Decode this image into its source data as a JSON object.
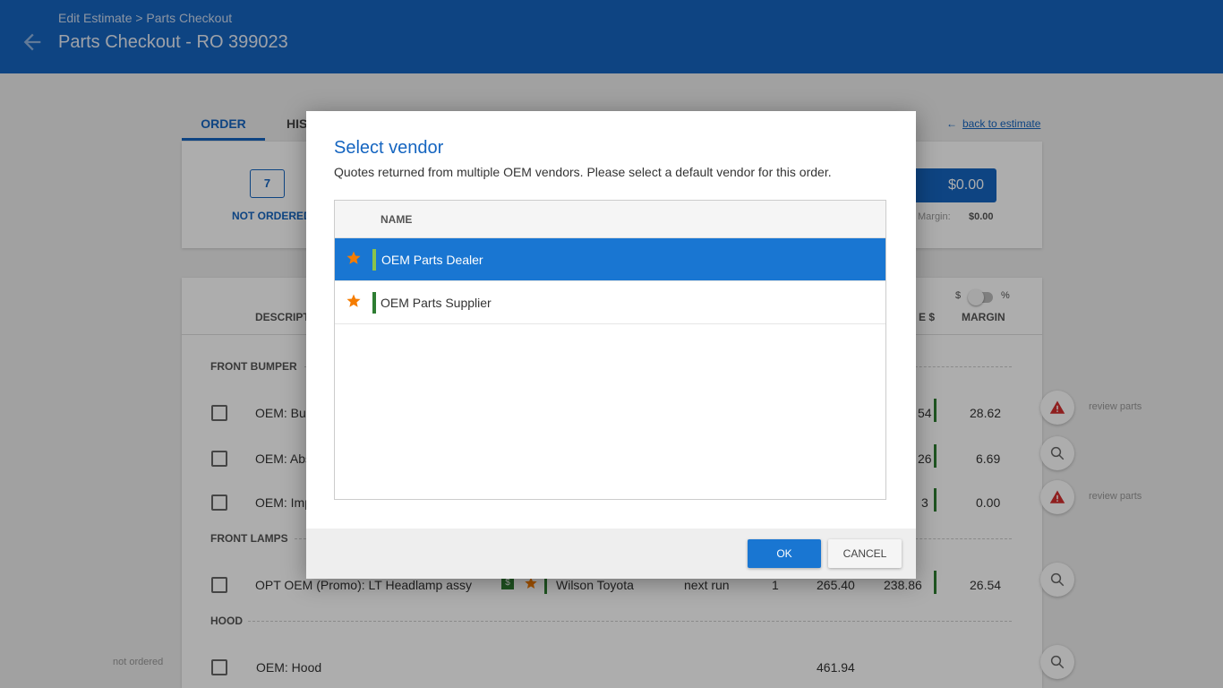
{
  "header": {
    "breadcrumb": "Edit Estimate > Parts Checkout",
    "title": "Parts Checkout - RO 399023"
  },
  "tabs": [
    {
      "label": "ORDER",
      "active": true
    },
    {
      "label": "HIS"
    }
  ],
  "back_link": "back to estimate",
  "summary": {
    "count": "7",
    "count_label": "NOT ORDERED",
    "total": "$0.00",
    "margin_label": "Margin:",
    "margin_value": "$0.00"
  },
  "parts_table": {
    "col_desc": "DESCRIPT",
    "col_price": "E $",
    "col_margin": "MARGIN",
    "toggle_dollar": "$",
    "toggle_percent": "%",
    "sections": [
      {
        "title": "FRONT BUMPER",
        "rows": [
          {
            "desc": "OEM: Bur",
            "price": "54",
            "margin": "28.62",
            "side_text": "review parts"
          },
          {
            "desc": "OEM: Abs",
            "price": "26",
            "margin": "6.69"
          },
          {
            "desc": "OEM: Imp",
            "price": "3",
            "margin": "0.00",
            "side_text": "review parts"
          }
        ]
      },
      {
        "title": "FRONT LAMPS",
        "rows": [
          {
            "desc": "OPT OEM (Promo): LT Headlamp assy",
            "vendor": "Wilson Toyota",
            "delivery": "next run",
            "qty": "1",
            "list": "265.40",
            "price": "238.86",
            "margin": "26.54"
          }
        ]
      },
      {
        "title": "HOOD",
        "rows": [
          {
            "desc": "OEM: Hood",
            "list": "461.94"
          }
        ]
      }
    ],
    "status_left": "not ordered"
  },
  "dialog": {
    "title": "Select vendor",
    "subtitle": "Quotes returned from multiple OEM vendors.  Please select a default vendor for this order.",
    "column_name": "NAME",
    "vendors": [
      {
        "name": "OEM Parts Dealer",
        "selected": true,
        "bar_color": "#8bc34a"
      },
      {
        "name": "OEM Parts Supplier",
        "selected": false,
        "bar_color": "#2e7d32"
      }
    ],
    "ok_label": "OK",
    "cancel_label": "CANCEL"
  },
  "colors": {
    "primary": "#1565c0",
    "selected_row": "#1976d2",
    "star": "#f57c00",
    "alert": "#d32f2f"
  }
}
